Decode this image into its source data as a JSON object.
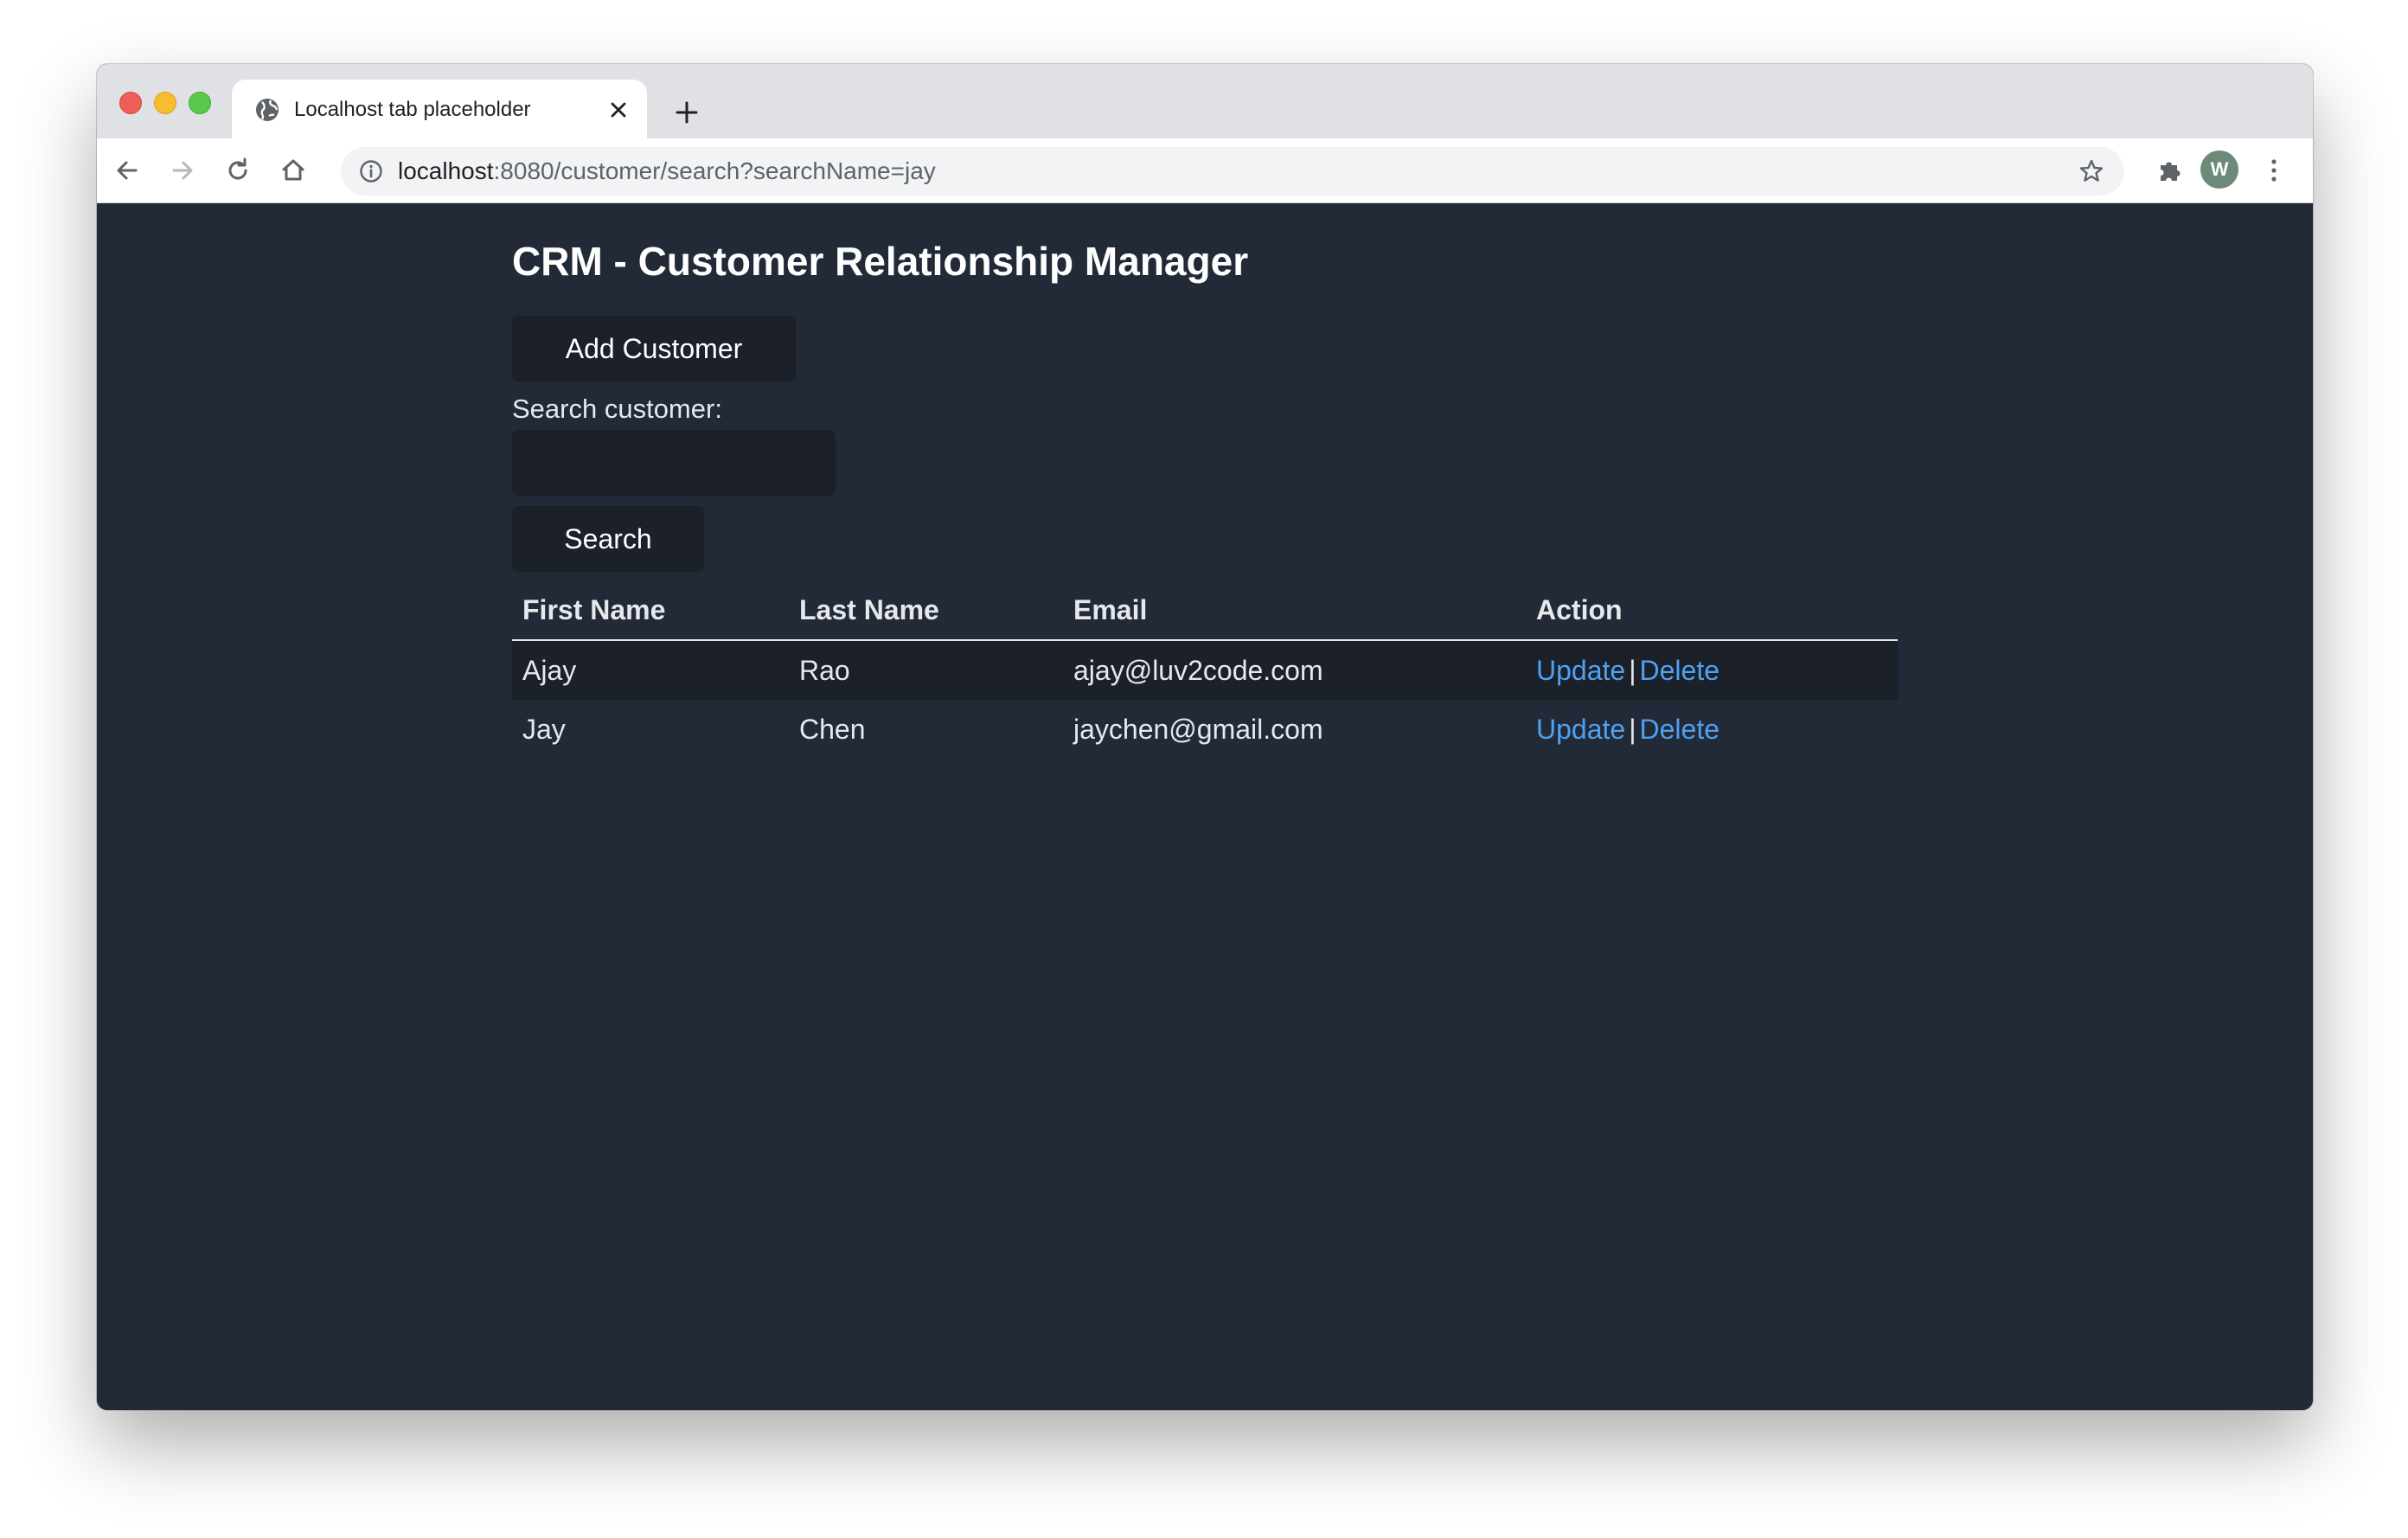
{
  "browser": {
    "tab_title": "Localhost tab placeholder",
    "url_host": "localhost",
    "url_path": ":8080/customer/search?searchName=jay",
    "avatar_initial": "W"
  },
  "page": {
    "title": "CRM - Customer Relationship Manager",
    "add_button_label": "Add Customer",
    "search_label": "Search customer:",
    "search_value": "",
    "search_button_label": "Search"
  },
  "table": {
    "headers": {
      "first_name": "First Name",
      "last_name": "Last Name",
      "email": "Email",
      "action": "Action"
    },
    "rows": [
      {
        "first_name": "Ajay",
        "last_name": "Rao",
        "email": "ajay@luv2code.com",
        "update": "Update",
        "separator": "|",
        "delete": "Delete"
      },
      {
        "first_name": "Jay",
        "last_name": "Chen",
        "email": "jaychen@gmail.com",
        "update": "Update",
        "separator": "|",
        "delete": "Delete"
      }
    ]
  },
  "colors": {
    "page_background": "#232a37",
    "button_background": "#1b2029",
    "link": "#4ea1f3"
  }
}
